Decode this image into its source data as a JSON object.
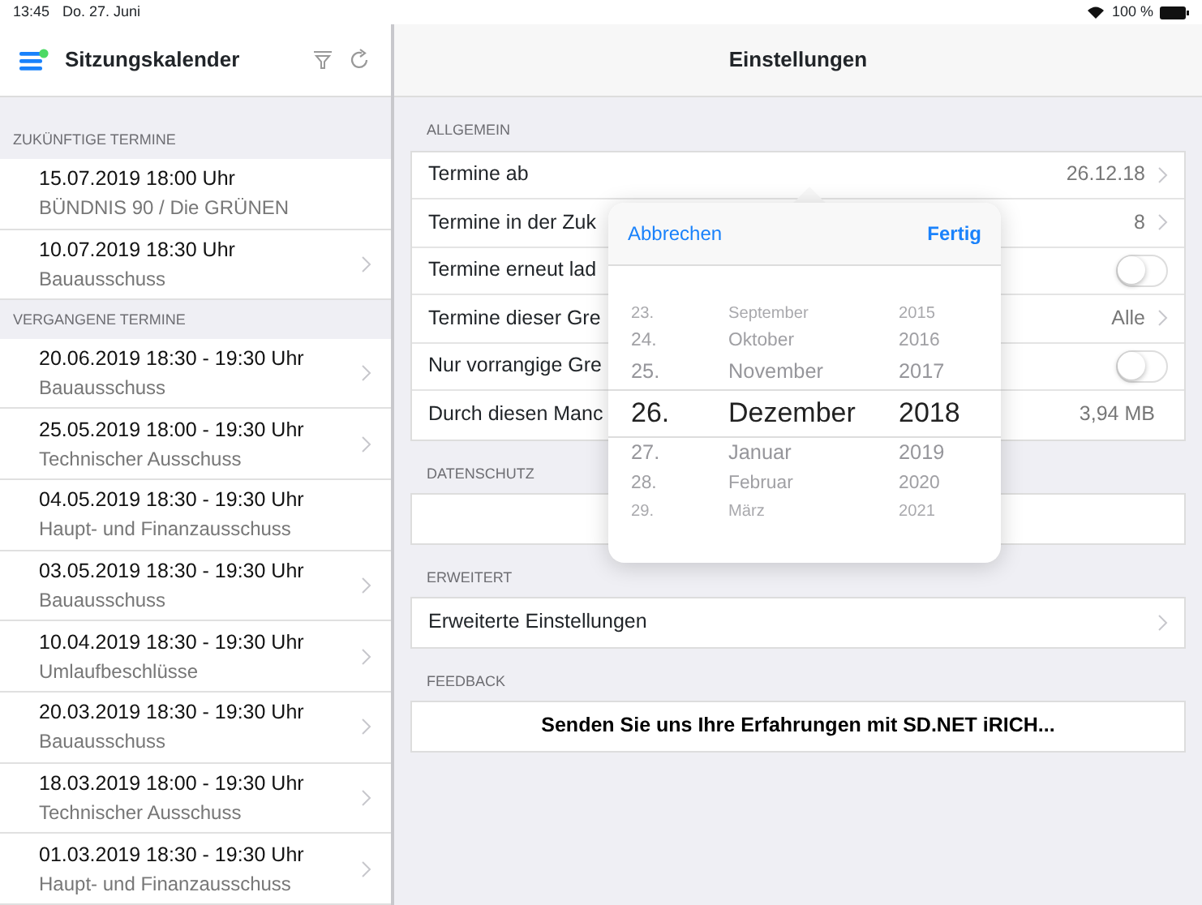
{
  "status_bar": {
    "time": "13:45",
    "date": "Do. 27. Juni",
    "battery": "100 %"
  },
  "sidebar": {
    "title": "Sitzungskalender",
    "sections": [
      {
        "header": "ZUKÜNFTIGE TERMINE",
        "items": [
          {
            "title": "15.07.2019 18:00 Uhr",
            "subtitle": "BÜNDNIS 90 / Die GRÜNEN",
            "disclosure": false
          },
          {
            "title": "10.07.2019 18:30 Uhr",
            "subtitle": "Bauausschuss",
            "disclosure": true
          }
        ]
      },
      {
        "header": "VERGANGENE TERMINE",
        "items": [
          {
            "title": "20.06.2019 18:30 -  19:30 Uhr",
            "subtitle": "Bauausschuss",
            "disclosure": true
          },
          {
            "title": "25.05.2019 18:00 -  19:30 Uhr",
            "subtitle": "Technischer Ausschuss",
            "disclosure": true
          },
          {
            "title": "04.05.2019 18:30 -  19:30 Uhr",
            "subtitle": "Haupt- und Finanzausschuss",
            "disclosure": false
          },
          {
            "title": "03.05.2019 18:30 -  19:30 Uhr",
            "subtitle": "Bauausschuss",
            "disclosure": true
          },
          {
            "title": "10.04.2019 18:30 -  19:30 Uhr",
            "subtitle": "Umlaufbeschlüsse",
            "disclosure": true
          },
          {
            "title": "20.03.2019 18:30 -  19:30 Uhr",
            "subtitle": "Bauausschuss",
            "disclosure": true
          },
          {
            "title": "18.03.2019 18:00 -  19:30 Uhr",
            "subtitle": "Technischer Ausschuss",
            "disclosure": true
          },
          {
            "title": "01.03.2019 18:30 -  19:30 Uhr",
            "subtitle": "Haupt- und Finanzausschuss",
            "disclosure": true
          }
        ]
      }
    ]
  },
  "settings": {
    "title": "Einstellungen",
    "sections": [
      {
        "header": "ALLGEMEIN",
        "rows": [
          {
            "kind": "value",
            "label": "Termine ab",
            "value": "26.12.18",
            "disclosure": true
          },
          {
            "kind": "value",
            "label": "Termine in der Zuk",
            "value": "8",
            "disclosure": true
          },
          {
            "kind": "toggle",
            "label": "Termine erneut lad",
            "on": false
          },
          {
            "kind": "value",
            "label": "Termine dieser Gre",
            "value": "Alle",
            "disclosure": true
          },
          {
            "kind": "toggle",
            "label": "Nur vorrangige Gre",
            "on": false
          },
          {
            "kind": "value",
            "label": "Durch diesen Manc",
            "value": "3,94 MB",
            "disclosure": false
          }
        ]
      },
      {
        "header": "DATENSCHUTZ",
        "rows": [
          {
            "kind": "empty"
          }
        ]
      },
      {
        "header": "ERWEITERT",
        "rows": [
          {
            "kind": "value",
            "label": "Erweiterte Einstellungen",
            "disclosure": true
          }
        ]
      },
      {
        "header": "FEEDBACK",
        "rows": [
          {
            "kind": "action",
            "label": "Senden Sie uns Ihre Erfahrungen mit SD.NET iRICH..."
          }
        ]
      }
    ]
  },
  "date_picker": {
    "cancel": "Abbrechen",
    "done": "Fertig",
    "rows": [
      {
        "day": "23.",
        "month": "September",
        "year": "2015",
        "selected": false
      },
      {
        "day": "24.",
        "month": "Oktober",
        "year": "2016",
        "selected": false
      },
      {
        "day": "25.",
        "month": "November",
        "year": "2017",
        "selected": false
      },
      {
        "day": "26.",
        "month": "Dezember",
        "year": "2018",
        "selected": true
      },
      {
        "day": "27.",
        "month": "Januar",
        "year": "2019",
        "selected": false
      },
      {
        "day": "28.",
        "month": "Februar",
        "year": "2020",
        "selected": false
      },
      {
        "day": "29.",
        "month": "März",
        "year": "2021",
        "selected": false
      }
    ]
  }
}
